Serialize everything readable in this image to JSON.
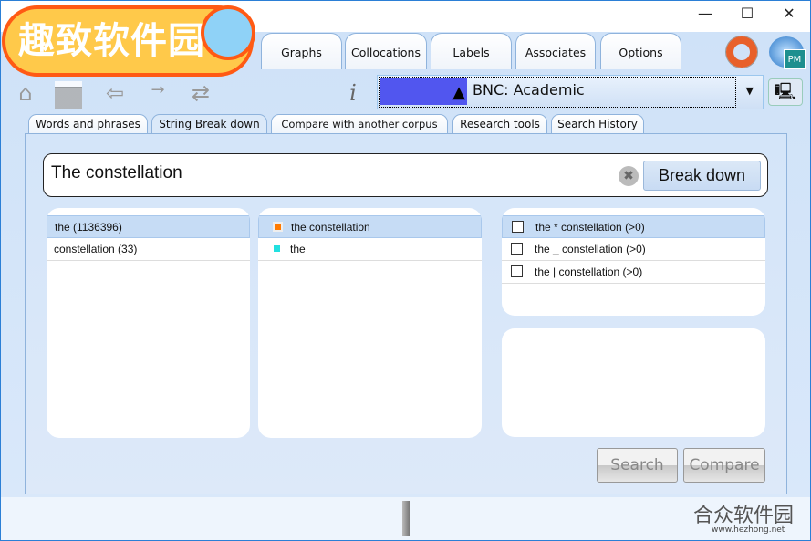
{
  "window": {
    "controls": {
      "minimize": "—",
      "maximize": "☐",
      "close": "✕"
    }
  },
  "logo": {
    "text": "趣致软件园"
  },
  "top_tabs": [
    {
      "label": "Graphs"
    },
    {
      "label": "Collocations"
    },
    {
      "label": "Labels"
    },
    {
      "label": "Associates"
    },
    {
      "label": "Options"
    }
  ],
  "toolbar": {
    "icons": [
      "home-icon",
      "table-add-icon",
      "back-arrow-icon",
      "forward-arrow-icon",
      "swap-arrows-icon",
      "info-icon",
      "lifebuoy-icon",
      "pm-globe-icon",
      "network-computer-icon"
    ],
    "info": "i"
  },
  "corpus": {
    "selected": "BNC: Academic",
    "swatch_color": "#5156ef"
  },
  "sub_tabs": [
    {
      "label": "Words and phrases"
    },
    {
      "label": "String Break down",
      "active": true
    },
    {
      "label": "Compare with another corpus"
    },
    {
      "label": "Research tools"
    },
    {
      "label": "Search History"
    }
  ],
  "search": {
    "value": "The constellation",
    "button": "Break down"
  },
  "words_list": [
    {
      "label": "the  (1136396)",
      "selected": true
    },
    {
      "label": "constellation  (33)"
    }
  ],
  "phrases_list": [
    {
      "label": "the constellation",
      "color": "#ff7a00",
      "selected": true
    },
    {
      "label": "the",
      "color": "#22e0e0"
    }
  ],
  "patterns_list": [
    {
      "label": "the * constellation (>0)",
      "checked": false,
      "selected": true
    },
    {
      "label": "the _ constellation (>0)",
      "checked": false
    },
    {
      "label": "the | constellation (>0)",
      "checked": false
    }
  ],
  "actions": {
    "search": "Search",
    "compare": "Compare"
  },
  "watermark": {
    "text": "合众软件园",
    "url": "www.hezhong.net"
  }
}
